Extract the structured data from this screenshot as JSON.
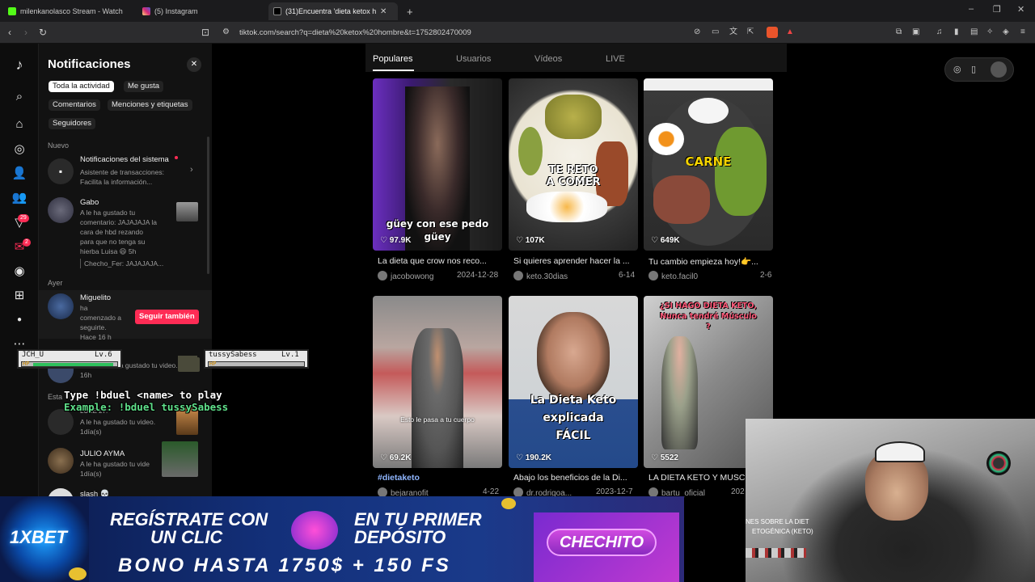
{
  "browser": {
    "tabs": [
      {
        "label": "milenkanolasco Stream - Watch",
        "color": "#53fc18"
      },
      {
        "label": "(5) Instagram",
        "color": "#d62976"
      },
      {
        "label": "(31)Encuentra 'dieta ketox hombr",
        "color": "#ffffff"
      }
    ],
    "url": "tiktok.com/search?q=dieta%20ketox%20hombre&t=1752802470009",
    "new_tab": "+",
    "minimize": "–",
    "restore": "❐",
    "close": "✕"
  },
  "rail": {
    "badges": {
      "inbox": "29",
      "messages": "2"
    }
  },
  "notifications": {
    "title": "Notificaciones",
    "filters": [
      "Toda la actividad",
      "Me gusta",
      "Comentarios",
      "Menciones y etiquetas",
      "Seguidores"
    ],
    "section_new": "Nuevo",
    "section_yesterday": "Ayer",
    "section_week": "Esta",
    "system": {
      "name": "Notificaciones del sistema",
      "line1": "Asistente de transacciones:",
      "line2": "Facilita la información..."
    },
    "gabo": {
      "name": "Gabo",
      "lines": [
        "A le ha gustado tu",
        "comentario: JAJAJAJA la",
        "cara de hbd rezando",
        "para que no tenga su",
        "hierba Luisa 😆 5h"
      ],
      "reply": "Checho_Fer: JAJAJAJA..."
    },
    "miguelito": {
      "name": "Miguelito",
      "lines": [
        "ha",
        "comenzado a",
        "seguirte."
      ],
      "time": "Hace 16 h",
      "button": "Seguir también"
    },
    "row4": {
      "text": "e ha gustado tu video.",
      "time": "16h"
    },
    "row5": {
      "name": "LUEE 27:",
      "text": "A le ha gustado tu video.",
      "time": "1día(s)"
    },
    "row6": {
      "name": "JULIO AYMA",
      "text": "A le ha gustado tu vide",
      "time": "1día(s)"
    },
    "row7": {
      "name": "slash 💀"
    }
  },
  "search": {
    "tabs": [
      "Populares",
      "Usuarios",
      "Vídeos",
      "LIVE"
    ],
    "videos": [
      {
        "views": "97.9K",
        "caption": "La dieta que crow nos reco...",
        "author": "jacobowong",
        "date": "2024-12-28",
        "overlay": "güey con ese pedo\ngüey"
      },
      {
        "views": "107K",
        "caption": "Si quieres aprender hacer la ...",
        "author": "keto.30dias",
        "date": "6-14",
        "overlay": "TE RETO\nA COMER"
      },
      {
        "views": "649K",
        "caption": "Tu cambio empieza hoy!👉...",
        "author": "keto.facil0",
        "date": "2-6",
        "overlay": "CARNE"
      },
      {
        "views": "69.2K",
        "caption": "#dietaketo",
        "author": "bejaranofit",
        "date": "4-22",
        "overlay": "Esto le pasa a tu cuerpo"
      },
      {
        "views": "190.2K",
        "caption": "Abajo los beneficios de la Di...",
        "author": "dr.rodrigoa...",
        "date": "2023-12-7",
        "overlay": "La Dieta Keto\nexplicada\nFÁCIL"
      },
      {
        "views": "5522",
        "caption": "LA DIETA KETO Y MUSCU...",
        "author": "bartu_oficial",
        "date": "202",
        "overlay": "¿SI HAGO DIETA KETO,\nNunca tendré Músculo\n?"
      }
    ]
  },
  "overlay": {
    "player1": {
      "name": "JCH_U",
      "level": "Lv.6",
      "hp": "HP",
      "hp_fraction": 0.95
    },
    "player2": {
      "name": "tussySabess",
      "level": "Lv.1",
      "hp": "HP",
      "hp_fraction": 0.0
    },
    "duel_line1": "Type !bduel <name> to play",
    "duel_line2": "Example: !bduel tussySabess"
  },
  "banner": {
    "brand": "1XBET",
    "line1a": "REGÍSTRATE CON",
    "line1b": "UN CLIC",
    "line2a": "EN TU PRIMER",
    "line2b": "DEPÓSITO",
    "bonus": "BONO HASTA 1750$ + 150 FS",
    "code": "CHECHITO"
  },
  "webcam": {
    "caption1": "NES SOBRE LA DIET",
    "caption2": "ETOGÉNICA (KETO)"
  }
}
